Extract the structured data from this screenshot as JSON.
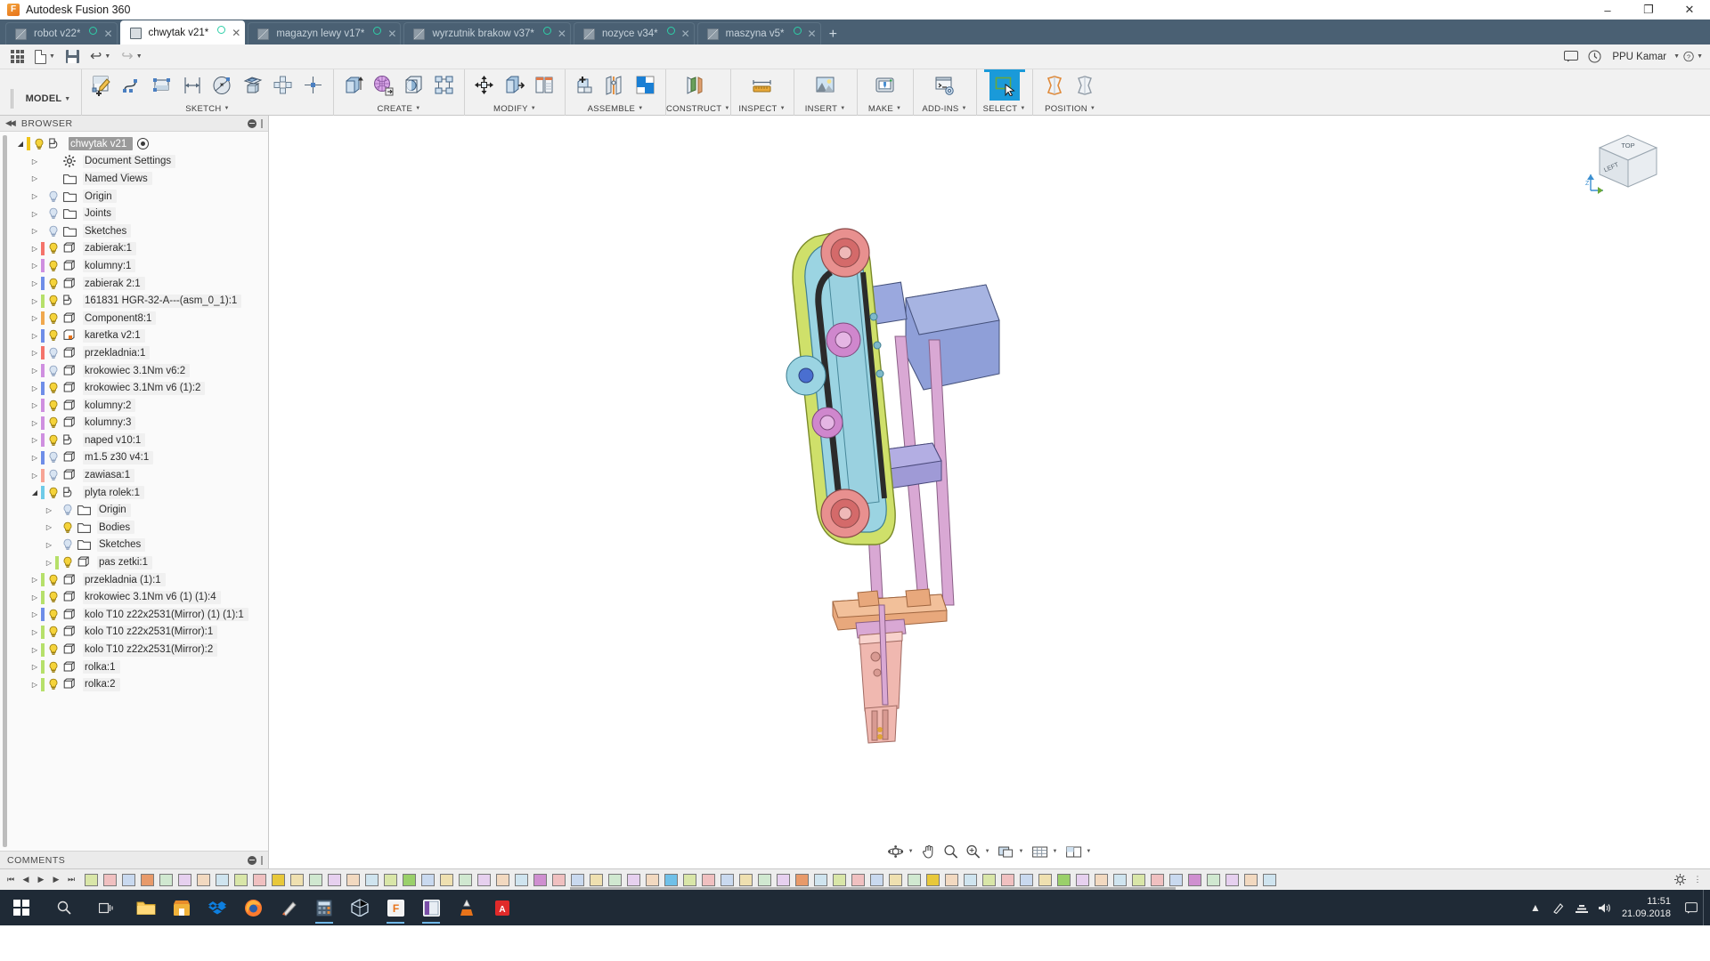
{
  "window": {
    "app_title": "Autodesk Fusion 360",
    "app_icon": "fusion-logo-icon",
    "minimize": "–",
    "maximize": "❐",
    "close": "✕"
  },
  "doc_tabs": [
    {
      "label": "robot v22*",
      "active": false
    },
    {
      "label": "chwytak v21*",
      "active": true
    },
    {
      "label": "magazyn lewy v17*",
      "active": false
    },
    {
      "label": "wyrzutnik brakow v37*",
      "active": false
    },
    {
      "label": "nozyce v34*",
      "active": false
    },
    {
      "label": "maszyna v5*",
      "active": false
    }
  ],
  "tab_new_label": "+",
  "quickbar": {
    "app_grid": "app-grid-icon",
    "new_doc": "new-document-icon",
    "save": "save-icon",
    "undo": "undo-icon",
    "redo": "redo-icon",
    "comments_panel": "comments-icon",
    "job_status": "job-status-icon",
    "user": "PPU Kamar",
    "help": "help-icon"
  },
  "ribbon": {
    "workspace": "MODEL",
    "groups": [
      {
        "label": "SKETCH",
        "icons": [
          "create-sketch-icon",
          "spline-icon",
          "rectangle-icon",
          "dimension-icon",
          "circle-icon",
          "offset-plane-sketch-icon",
          "pattern-icon",
          "point-icon"
        ]
      },
      {
        "label": "CREATE",
        "icons": [
          "extrude-icon",
          "revolve-mesh-icon",
          "hole-icon",
          "box-join-icon"
        ]
      },
      {
        "label": "MODIFY",
        "icons": [
          "move-copy-icon",
          "press-pull-icon",
          "align-icon"
        ]
      },
      {
        "label": "ASSEMBLE",
        "icons": [
          "new-component-icon",
          "joint-icon",
          "as-built-joint-icon"
        ]
      },
      {
        "label": "CONSTRUCT",
        "icons": [
          "offset-plane-icon"
        ]
      },
      {
        "label": "INSPECT",
        "icons": [
          "measure-icon"
        ]
      },
      {
        "label": "INSERT",
        "icons": [
          "insert-decal-icon"
        ]
      },
      {
        "label": "MAKE",
        "icons": [
          "3d-print-icon"
        ]
      },
      {
        "label": "ADD-INS",
        "icons": [
          "scripts-addins-icon"
        ]
      },
      {
        "label": "SELECT",
        "icons": [
          "select-window-icon"
        ],
        "highlighted": true
      },
      {
        "label": "POSITION",
        "icons": [
          "capture-position-icon",
          "revert-position-icon"
        ]
      }
    ]
  },
  "browser": {
    "title": "BROWSER",
    "collapse_icon": "collapse-left-icon",
    "minus_icon": "minimize-panel-icon",
    "tree": [
      {
        "label": "chwytak v21",
        "indent": 0,
        "arrow": "open",
        "icon": "assembly-icon",
        "bulb": "on",
        "color": "#f0c419",
        "root": true,
        "eye": true
      },
      {
        "label": "Document Settings",
        "indent": 1,
        "arrow": "closed",
        "icon": "gear-icon",
        "bulb": "none",
        "color": ""
      },
      {
        "label": "Named Views",
        "indent": 1,
        "arrow": "closed",
        "icon": "folder-icon",
        "bulb": "none",
        "color": ""
      },
      {
        "label": "Origin",
        "indent": 1,
        "arrow": "closed",
        "icon": "folder-icon",
        "bulb": "off",
        "color": ""
      },
      {
        "label": "Joints",
        "indent": 1,
        "arrow": "closed",
        "icon": "folder-icon",
        "bulb": "off",
        "color": ""
      },
      {
        "label": "Sketches",
        "indent": 1,
        "arrow": "closed",
        "icon": "folder-icon",
        "bulb": "off",
        "color": ""
      },
      {
        "label": "zabierak:1",
        "indent": 1,
        "arrow": "closed",
        "icon": "component-icon",
        "bulb": "on",
        "color": "#f4736a"
      },
      {
        "label": "kolumny:1",
        "indent": 1,
        "arrow": "closed",
        "icon": "component-icon",
        "bulb": "on",
        "color": "#cf8fe0"
      },
      {
        "label": "zabierak 2:1",
        "indent": 1,
        "arrow": "closed",
        "icon": "component-icon",
        "bulb": "on",
        "color": "#6e8de8"
      },
      {
        "label": "161831 HGR-32-A---(asm_0_1):1",
        "indent": 1,
        "arrow": "closed",
        "icon": "assembly-icon",
        "bulb": "on",
        "color": "#b6e06a"
      },
      {
        "label": "Component8:1",
        "indent": 1,
        "arrow": "closed",
        "icon": "component-icon",
        "bulb": "on",
        "color": "#f0a84e"
      },
      {
        "label": "karetka v2:1",
        "indent": 1,
        "arrow": "closed",
        "icon": "component-linked-icon",
        "bulb": "on",
        "color": "#6e8de8"
      },
      {
        "label": "przekladnia:1",
        "indent": 1,
        "arrow": "closed",
        "icon": "component-icon",
        "bulb": "off",
        "color": "#f4736a"
      },
      {
        "label": "krokowiec 3.1Nm v6:2",
        "indent": 1,
        "arrow": "closed",
        "icon": "component-icon",
        "bulb": "off",
        "color": "#cf8fe0"
      },
      {
        "label": "krokowiec 3.1Nm v6 (1):2",
        "indent": 1,
        "arrow": "closed",
        "icon": "component-icon",
        "bulb": "on",
        "color": "#6e8de8"
      },
      {
        "label": "kolumny:2",
        "indent": 1,
        "arrow": "closed",
        "icon": "component-icon",
        "bulb": "on",
        "color": "#cf8fe0"
      },
      {
        "label": "kolumny:3",
        "indent": 1,
        "arrow": "closed",
        "icon": "component-icon",
        "bulb": "on",
        "color": "#cf8fe0"
      },
      {
        "label": "naped v10:1",
        "indent": 1,
        "arrow": "closed",
        "icon": "assembly-icon",
        "bulb": "on",
        "color": "#cf8fe0"
      },
      {
        "label": "m1.5 z30 v4:1",
        "indent": 1,
        "arrow": "closed",
        "icon": "component-icon",
        "bulb": "off",
        "color": "#6e8de8"
      },
      {
        "label": "zawiasa:1",
        "indent": 1,
        "arrow": "closed",
        "icon": "component-icon",
        "bulb": "off",
        "color": "#f7a495"
      },
      {
        "label": "plyta rolek:1",
        "indent": 1,
        "arrow": "open",
        "icon": "assembly-icon",
        "bulb": "on",
        "color": "#6ecbe8"
      },
      {
        "label": "Origin",
        "indent": 2,
        "arrow": "closed",
        "icon": "folder-icon",
        "bulb": "off",
        "color": ""
      },
      {
        "label": "Bodies",
        "indent": 2,
        "arrow": "closed",
        "icon": "folder-icon",
        "bulb": "on",
        "color": ""
      },
      {
        "label": "Sketches",
        "indent": 2,
        "arrow": "closed",
        "icon": "folder-icon",
        "bulb": "off",
        "color": ""
      },
      {
        "label": "pas zetki:1",
        "indent": 2,
        "arrow": "closed",
        "icon": "component-icon",
        "bulb": "on",
        "color": "#b6e06a"
      },
      {
        "label": "przekladnia (1):1",
        "indent": 1,
        "arrow": "closed",
        "icon": "component-icon",
        "bulb": "on",
        "color": "#b6e06a"
      },
      {
        "label": "krokowiec 3.1Nm v6 (1) (1):4",
        "indent": 1,
        "arrow": "closed",
        "icon": "component-icon",
        "bulb": "on",
        "color": "#b6e06a"
      },
      {
        "label": "kolo T10 z22x2531(Mirror) (1) (1):1",
        "indent": 1,
        "arrow": "closed",
        "icon": "component-icon",
        "bulb": "on",
        "color": "#6e8de8"
      },
      {
        "label": "kolo T10 z22x2531(Mirror):1",
        "indent": 1,
        "arrow": "closed",
        "icon": "component-icon",
        "bulb": "on",
        "color": "#b6e06a"
      },
      {
        "label": "kolo T10 z22x2531(Mirror):2",
        "indent": 1,
        "arrow": "closed",
        "icon": "component-icon",
        "bulb": "on",
        "color": "#b6e06a"
      },
      {
        "label": "rolka:1",
        "indent": 1,
        "arrow": "closed",
        "icon": "component-icon",
        "bulb": "on",
        "color": "#b6e06a"
      },
      {
        "label": "rolka:2",
        "indent": 1,
        "arrow": "closed",
        "icon": "component-icon",
        "bulb": "on",
        "color": "#b6e06a"
      }
    ]
  },
  "comments": {
    "title": "COMMENTS"
  },
  "viewcube": {
    "top_label": "TOP",
    "left_label": "LEFT",
    "axis_z": "Z"
  },
  "navbar": {
    "orbit": "orbit-icon",
    "pan": "pan-icon",
    "zoom": "zoom-icon",
    "fit": "fit-icon",
    "display_settings": "display-settings-icon",
    "grid_snaps": "grid-snaps-icon",
    "viewports": "viewports-icon"
  },
  "timeline": {
    "controls": [
      "go-to-beginning-icon",
      "step-back-icon",
      "play-icon",
      "step-forward-icon",
      "go-to-end-icon"
    ],
    "feature_count": 64,
    "settings_icon": "timeline-settings-icon",
    "end_marker": "timeline-end-marker"
  },
  "taskbar": {
    "start": "windows-start-icon",
    "search": "search-icon",
    "task_view": "task-view-icon",
    "apps": [
      "file-explorer-icon",
      "microsoft-store-icon",
      "dropbox-icon",
      "firefox-icon",
      "paint-icon",
      "calculator-icon",
      "3d-viewer-icon",
      "fusion360-icon",
      "onenote-icon",
      "vlc-icon",
      "acrobat-reader-icon"
    ],
    "tray": [
      "action-center-icon",
      "pen-icon",
      "chevron-up-icon",
      "network-icon",
      "volume-icon"
    ],
    "time": "11:51",
    "date": "21.09.2018"
  }
}
